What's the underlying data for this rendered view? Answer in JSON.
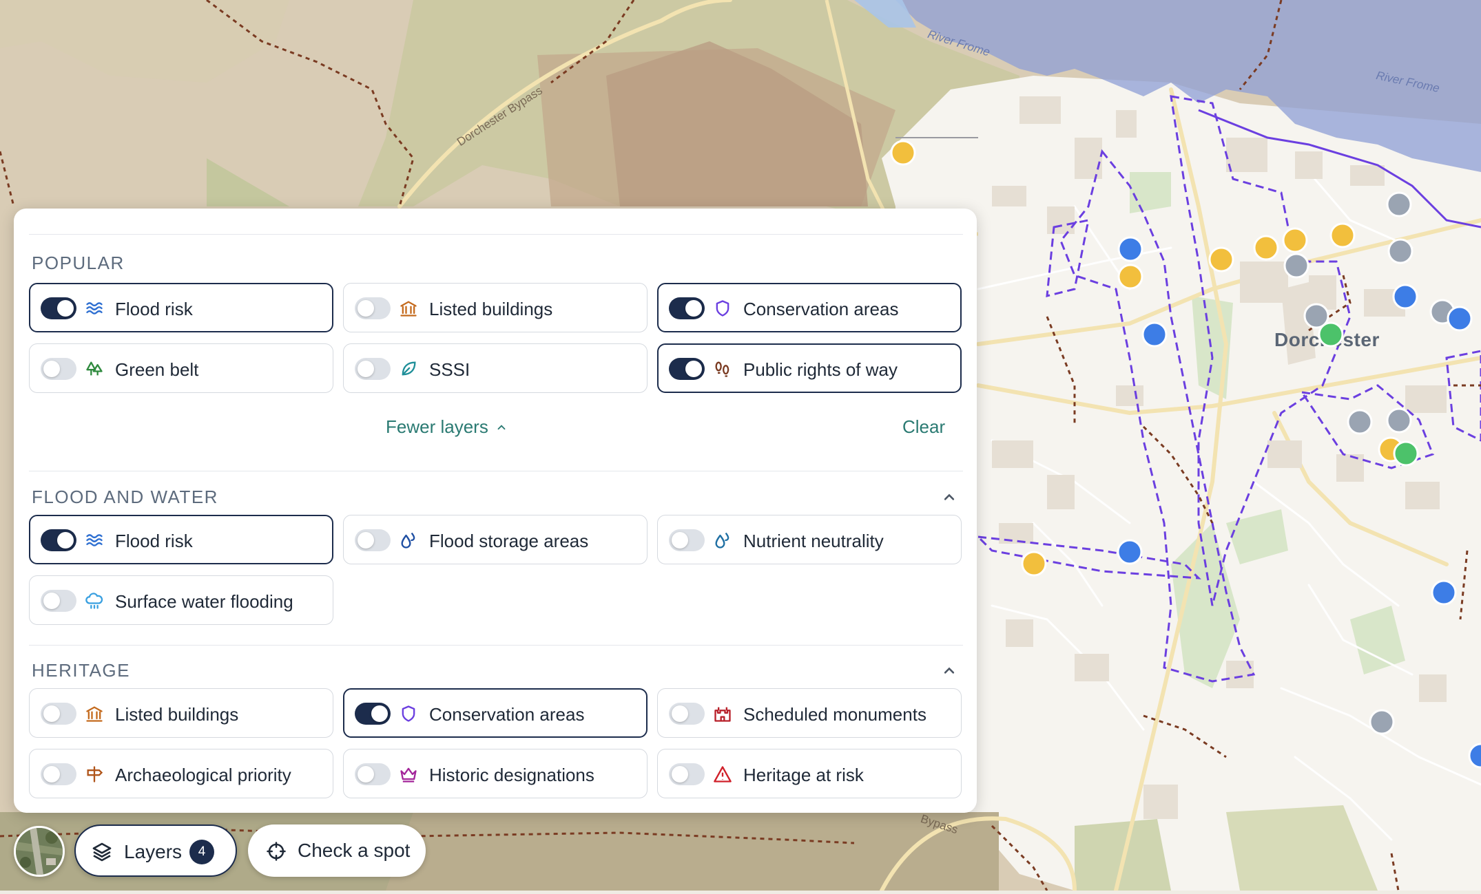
{
  "map": {
    "town_label": "Dorchester",
    "river_label_1": "River Frome",
    "river_label_2": "River Frome",
    "road_label_1": "Dorchester Bypass",
    "road_label_2": "Bypass"
  },
  "panel": {
    "popular": {
      "heading": "POPULAR",
      "items": [
        {
          "label": "Flood risk",
          "on": true,
          "icon": "waves-icon"
        },
        {
          "label": "Listed buildings",
          "on": false,
          "icon": "columns-building-icon"
        },
        {
          "label": "Conservation areas",
          "on": true,
          "icon": "shield-icon"
        },
        {
          "label": "Green belt",
          "on": false,
          "icon": "trees-icon"
        },
        {
          "label": "SSSI",
          "on": false,
          "icon": "leaf-icon"
        },
        {
          "label": "Public rights of way",
          "on": true,
          "icon": "footprints-icon"
        }
      ],
      "fewer_label": "Fewer layers",
      "clear_label": "Clear"
    },
    "flood_and_water": {
      "heading": "FLOOD AND WATER",
      "items": [
        {
          "label": "Flood risk",
          "on": true,
          "icon": "waves-icon"
        },
        {
          "label": "Flood storage areas",
          "on": false,
          "icon": "droplets-icon"
        },
        {
          "label": "Nutrient neutrality",
          "on": false,
          "icon": "droplets-icon"
        },
        {
          "label": "Surface water flooding",
          "on": false,
          "icon": "cloud-rain-icon"
        }
      ]
    },
    "heritage": {
      "heading": "HERITAGE",
      "items": [
        {
          "label": "Listed buildings",
          "on": false,
          "icon": "columns-building-icon"
        },
        {
          "label": "Conservation areas",
          "on": true,
          "icon": "shield-icon"
        },
        {
          "label": "Scheduled monuments",
          "on": false,
          "icon": "castle-icon"
        },
        {
          "label": "Archaeological priority",
          "on": false,
          "icon": "signpost-icon"
        },
        {
          "label": "Historic designations",
          "on": false,
          "icon": "crown-icon"
        },
        {
          "label": "Heritage at risk",
          "on": false,
          "icon": "alert-triangle-icon"
        }
      ]
    }
  },
  "toolbar": {
    "layers_label": "Layers",
    "layers_count": "4",
    "check_label": "Check a spot"
  },
  "colors": {
    "navy": "#1c2c4c",
    "teal_link": "#2a7a72",
    "flood_fill": "#8d9fd6",
    "conservation_line": "#6b3fe0",
    "rights_of_way": "#7a3b22",
    "marker_yellow": "#f2bf3d",
    "marker_blue": "#3d7de6",
    "marker_grey": "#9aa4b2",
    "marker_green": "#4cc26a"
  }
}
